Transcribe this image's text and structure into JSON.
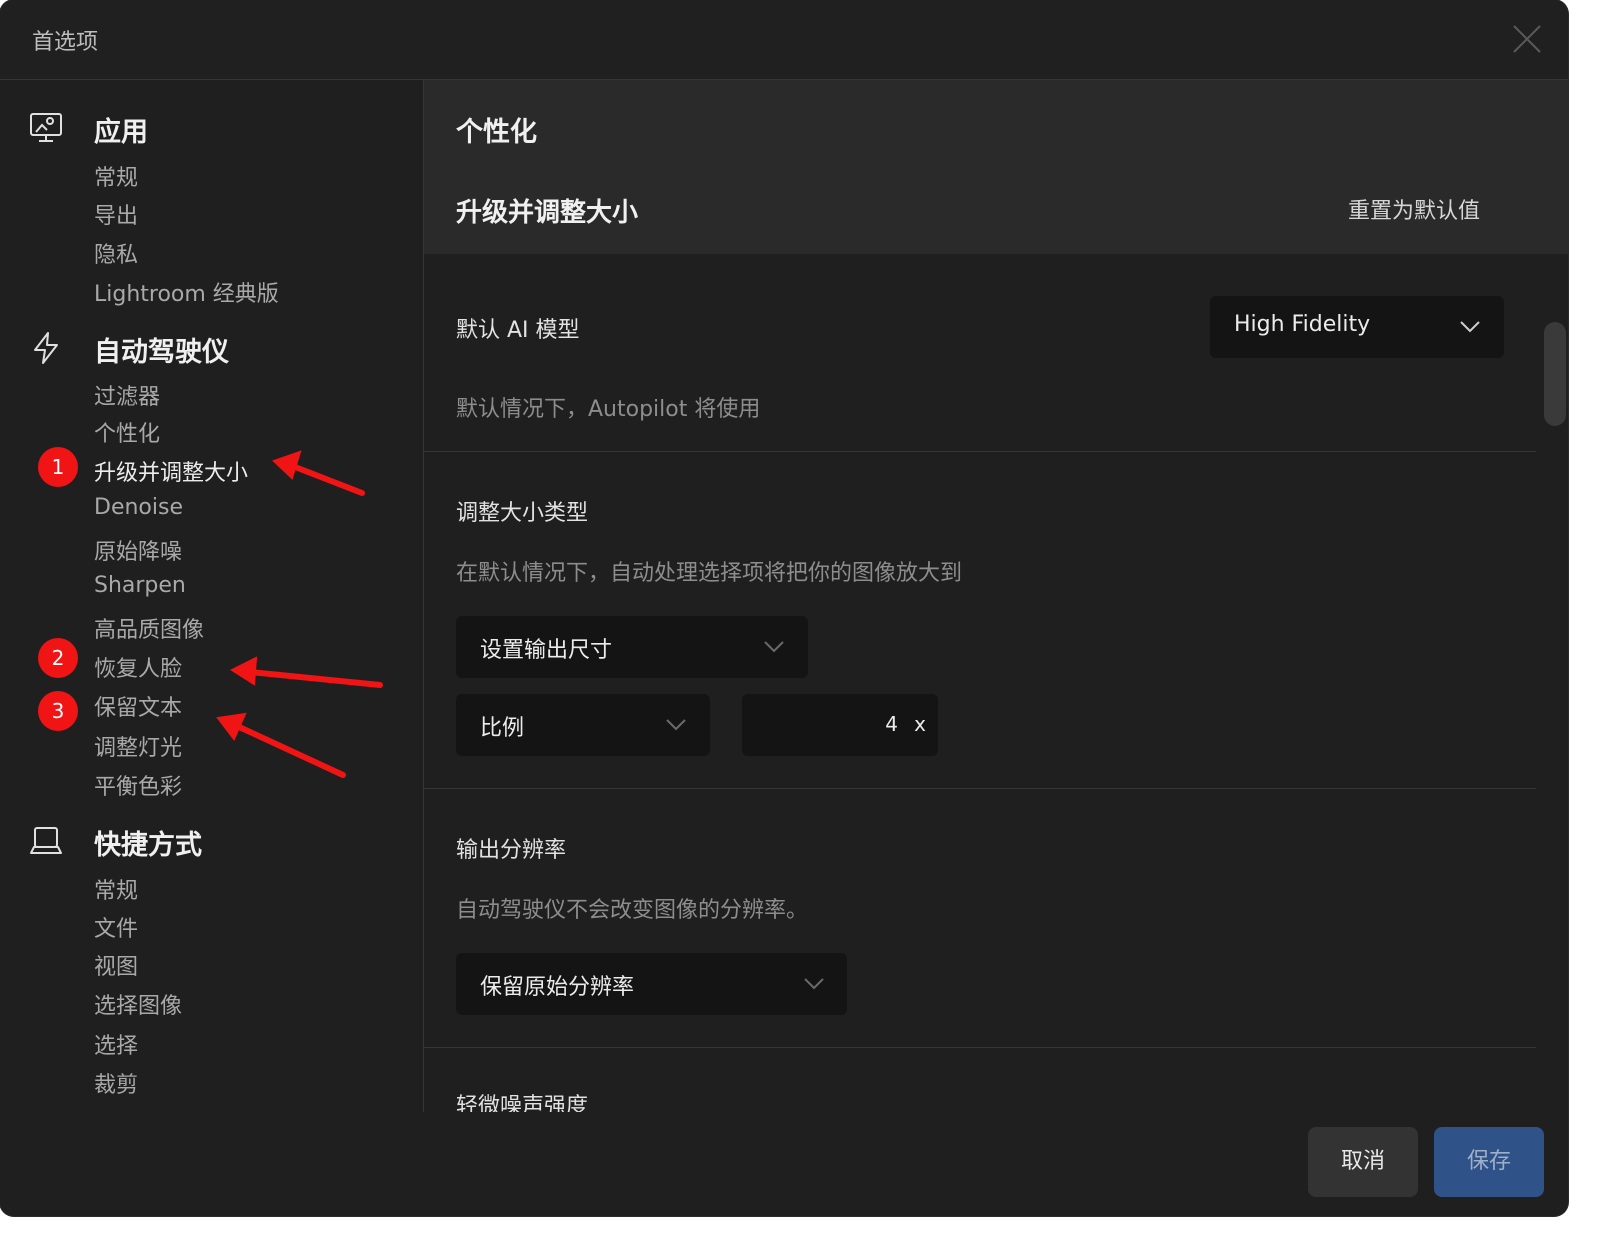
{
  "window": {
    "title": "首选项"
  },
  "sidebar": {
    "groups": [
      {
        "title": "应用",
        "icon": "monitor-settings-icon",
        "items": [
          "常规",
          "导出",
          "隐私",
          "Lightroom 经典版"
        ]
      },
      {
        "title": "自动驾驶仪",
        "icon": "lightning-icon",
        "items": [
          "过滤器",
          "个性化",
          "升级并调整大小",
          "Denoise",
          "原始降噪",
          "Sharpen",
          "高品质图像",
          "恢复人脸",
          "保留文本",
          "调整灯光",
          "平衡色彩"
        ]
      },
      {
        "title": "快捷方式",
        "icon": "laptop-icon",
        "items": [
          "常规",
          "文件",
          "视图",
          "选择图像",
          "选择",
          "裁剪"
        ]
      }
    ],
    "active_item": "升级并调整大小",
    "annotations": [
      "1",
      "2",
      "3"
    ],
    "annotation_color": "#f01414"
  },
  "content": {
    "section_title": "个性化",
    "subsection_title": "升级并调整大小",
    "reset_label": "重置为默认值",
    "ai_model": {
      "label": "默认 AI 模型",
      "value": "High Fidelity",
      "description": "默认情况下，Autopilot 将使用"
    },
    "resize_type": {
      "label": "调整大小类型",
      "description": "在默认情况下，自动处理选择项将把你的图像放大到",
      "mode_value": "设置输出尺寸",
      "scale_type_value": "比例",
      "scale_value": "4",
      "scale_unit": "x"
    },
    "resolution": {
      "label": "输出分辨率",
      "description": "自动驾驶仪不会改变图像的分辨率。",
      "value": "保留原始分辨率"
    },
    "noise": {
      "label": "轻微噪声强度"
    }
  },
  "footer": {
    "cancel_label": "取消",
    "save_label": "保存",
    "save_color": "#2f5288"
  }
}
